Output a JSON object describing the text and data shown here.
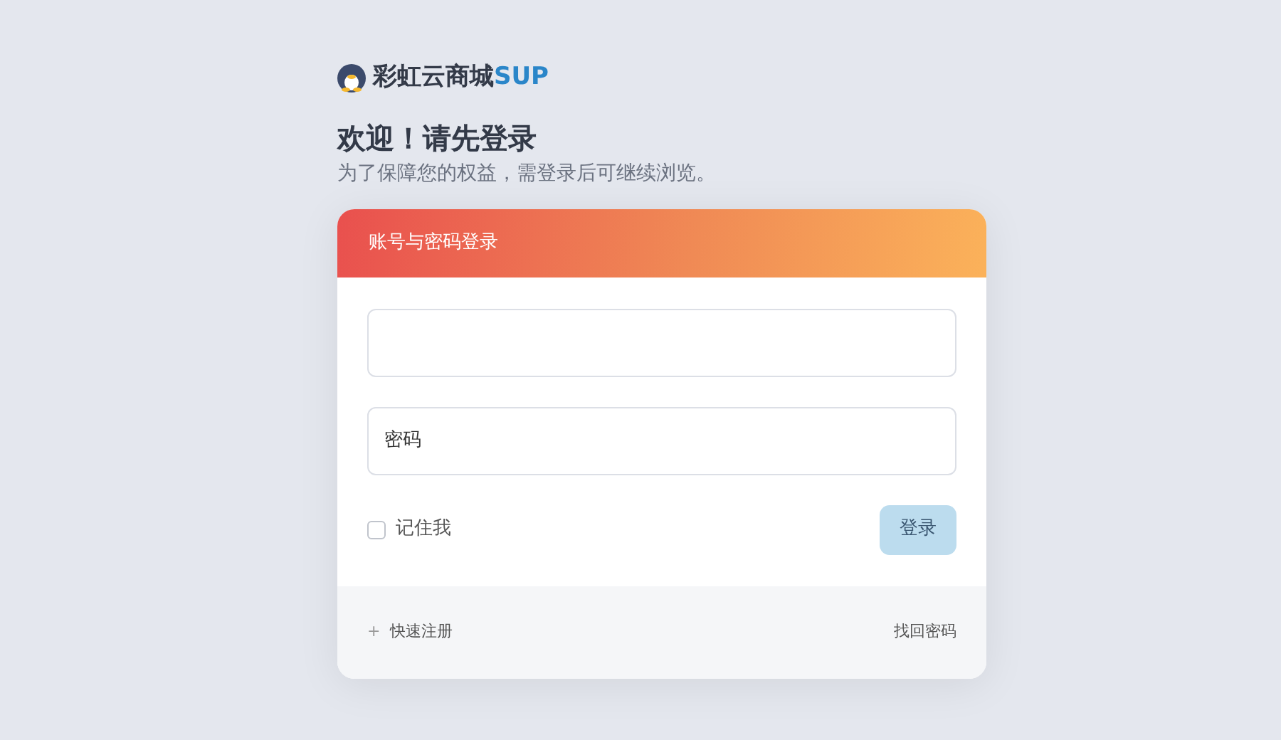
{
  "brand": {
    "name": "彩虹云商城",
    "suffix": "SUP"
  },
  "heading": "欢迎！请先登录",
  "subheading": "为了保障您的权益，需登录后可继续浏览。",
  "card": {
    "title": "账号与密码登录",
    "password": {
      "placeholder": "密码"
    },
    "remember": {
      "label": "记住我",
      "checked": false
    },
    "submit": "登录",
    "register": {
      "icon": "+",
      "label": "快速注册"
    },
    "forgot": "找回密码"
  }
}
